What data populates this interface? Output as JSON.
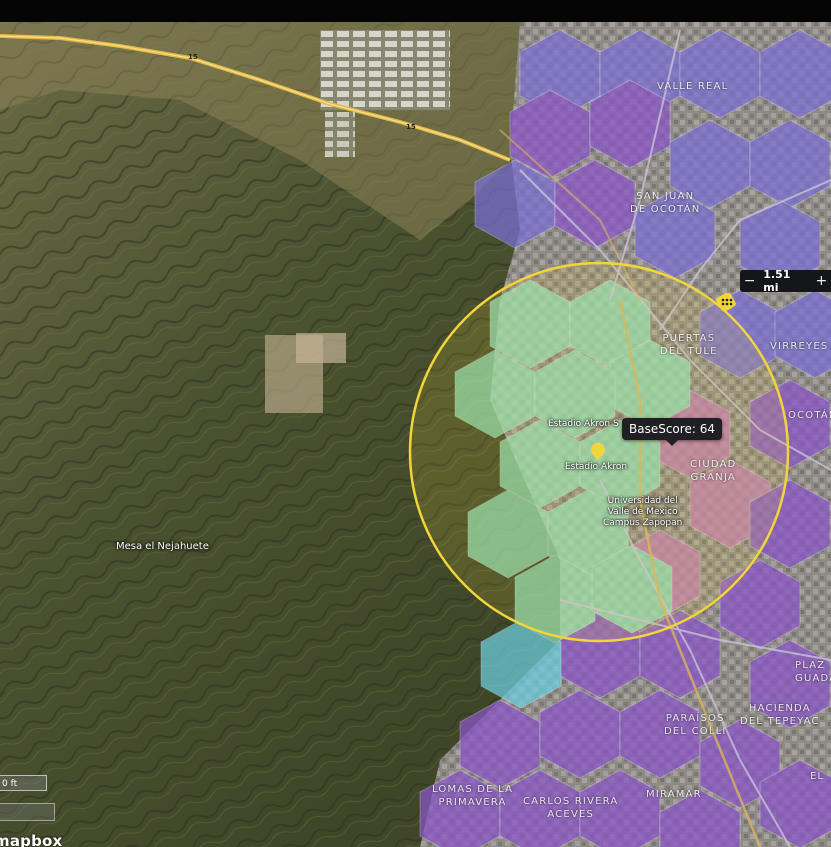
{
  "map": {
    "places": [
      {
        "id": "valle-real",
        "label": "VALLE REAL"
      },
      {
        "id": "san-juan",
        "label": "SAN JUAN\nDE OCOTÁN"
      },
      {
        "id": "puertas",
        "label": "PUERTAS\nDEL TULE"
      },
      {
        "id": "virreyes",
        "label": "VIRREYES"
      },
      {
        "id": "ocotan",
        "label": "OCOTÁN"
      },
      {
        "id": "ciudad-granja",
        "label": "CIUDAD\nGRANJA"
      },
      {
        "id": "plaza",
        "label": "PLAZ\nGUADAE"
      },
      {
        "id": "hacienda",
        "label": "HACIENDA\nDEL TEPEYAC"
      },
      {
        "id": "paraisos",
        "label": "PARAÍSOS\nDEL COLLI"
      },
      {
        "id": "miramar",
        "label": "MIRAMAR"
      },
      {
        "id": "lomas",
        "label": "LOMAS DE LA\nPRIMAVERA"
      },
      {
        "id": "carlos",
        "label": "CARLOS RIVERA\nACEVES"
      },
      {
        "id": "el",
        "label": "EL"
      }
    ],
    "pois": {
      "stadium_label_1": "Estadio Akron S",
      "stadium_label_2": "Estadio Akron",
      "university": "Universidad del\nValle de Mexico\nCampus Zapopan"
    },
    "mountain": "Mesa el Nejahuete",
    "road_shield_1": "15",
    "road_shield_2": "15",
    "tooltip": "BaseScore: 64",
    "radius": {
      "minus": "−",
      "value": "1.51 mi",
      "plus": "+"
    },
    "scale_label": "0 ft",
    "attribution": "mapbox"
  },
  "colors": {
    "accent_yellow": "#f2d53b",
    "hex_green": "#8fe3c0",
    "hex_cyan": "#6ccfe0",
    "hex_purple": "#8a55c9",
    "hex_blue_purple": "#7a6fd6",
    "hex_pink": "#c47ab8"
  }
}
